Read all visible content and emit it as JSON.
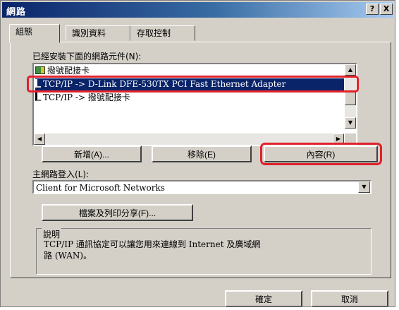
{
  "window": {
    "title": "網路",
    "help_label": "?",
    "close_label": "X"
  },
  "tabs": [
    {
      "label": "組態"
    },
    {
      "label": "識別資料"
    },
    {
      "label": "存取控制"
    }
  ],
  "components": {
    "label": "已經安裝下面的網路元件(N):",
    "items": [
      {
        "label": "撥號配接卡",
        "icon": "network-adapter-icon",
        "selected": false
      },
      {
        "label": "TCP/IP -> D-Link DFE-530TX PCI Fast Ethernet Adapter",
        "icon": "protocol-icon",
        "selected": true
      },
      {
        "label": "TCP/IP -> 撥號配接卡",
        "icon": "protocol-icon",
        "selected": false
      }
    ]
  },
  "buttons": {
    "add": "新增(A)...",
    "remove": "移除(E)",
    "properties": "內容(R)",
    "file_print_sharing": "檔案及列印分享(F)...",
    "ok": "確定",
    "cancel": "取消"
  },
  "logon": {
    "label": "主網路登入(L):",
    "value": "Client for Microsoft Networks"
  },
  "description": {
    "title": "說明",
    "text": "TCP/IP 通訊協定可以讓您用來連線到 Internet 及廣域網\n路 (WAN)。"
  },
  "colors": {
    "highlight_annotation": "#e0212b",
    "selection": "#0a246a",
    "title_bar": "#0a246a"
  }
}
